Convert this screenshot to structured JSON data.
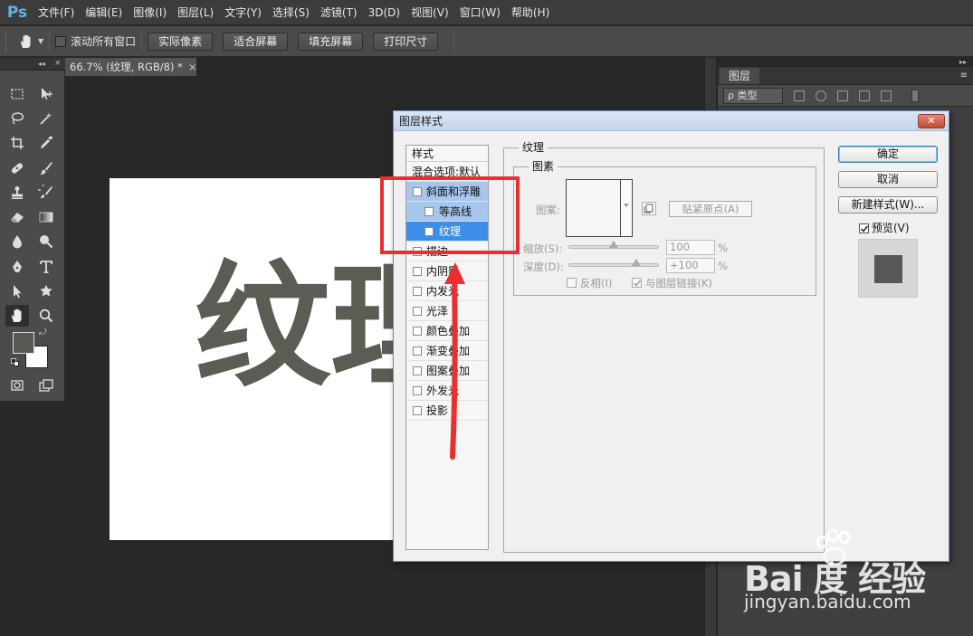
{
  "app": {
    "logo": "Ps"
  },
  "menu": [
    "文件(F)",
    "编辑(E)",
    "图像(I)",
    "图层(L)",
    "文字(Y)",
    "选择(S)",
    "滤镜(T)",
    "3D(D)",
    "视图(V)",
    "窗口(W)",
    "帮助(H)"
  ],
  "options": {
    "scroll_all_label": "滚动所有窗口",
    "buttons": [
      "实际像素",
      "适合屏幕",
      "填充屏幕",
      "打印尺寸"
    ]
  },
  "document": {
    "tab_title": "66.7% (纹理, RGB/8) *",
    "close": "×",
    "canvas_text": "纹理"
  },
  "layers_panel": {
    "tab": "图层",
    "filter_kind": "ρ 类型"
  },
  "dialog": {
    "title": "图层样式",
    "close": "✕",
    "styles_header": "样式",
    "blend_options": "混合选项:默认",
    "styles": [
      {
        "label": "斜面和浮雕",
        "state": "highlight"
      },
      {
        "label": "等高线",
        "state": "highlight-sub"
      },
      {
        "label": "纹理",
        "state": "selected-sub"
      },
      {
        "label": "描边",
        "state": ""
      },
      {
        "label": "内阴影",
        "state": ""
      },
      {
        "label": "内发光",
        "state": ""
      },
      {
        "label": "光泽",
        "state": ""
      },
      {
        "label": "颜色叠加",
        "state": ""
      },
      {
        "label": "渐变叠加",
        "state": ""
      },
      {
        "label": "图案叠加",
        "state": ""
      },
      {
        "label": "外发光",
        "state": ""
      },
      {
        "label": "投影",
        "state": ""
      }
    ],
    "texture": {
      "group_title": "纹理",
      "element_title": "图素",
      "pattern_label": "图案:",
      "snap_origin": "贴紧原点(A)",
      "scale_label": "缩放(S):",
      "scale_value": "100",
      "scale_level": 0.5,
      "depth_label": "深度(D):",
      "depth_value": "+100",
      "depth_level": 0.75,
      "percent": "%",
      "invert_label": "反相(I)",
      "link_label": "与图层链接(K)"
    },
    "buttons": {
      "ok": "确定",
      "cancel": "取消",
      "new_style": "新建样式(W)..."
    },
    "preview_label": "预览(V)"
  },
  "watermark": {
    "logo": "Bai 度 经验",
    "url": "jingyan.baidu.com"
  },
  "colors": {
    "annotation_red": "#e9302e",
    "selected_blue": "#3d8ee8",
    "highlight_blue": "#a7c6ee"
  }
}
